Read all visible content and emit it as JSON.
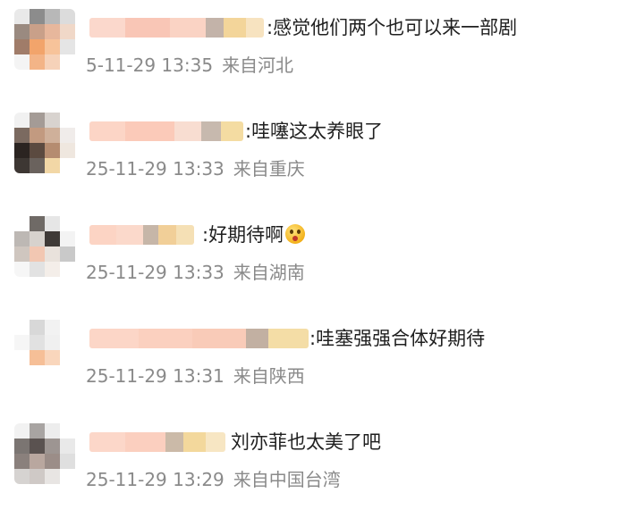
{
  "comments": [
    {
      "text": ":感觉他们两个也可以来一部剧",
      "date": "5-11-29 13:35",
      "location": "来自河北"
    },
    {
      "text": ":哇噻这太养眼了",
      "date": "25-11-29 13:33",
      "location": "来自重庆"
    },
    {
      "text": ":好期待啊",
      "emoji": "surprised-face-emoji",
      "date": "25-11-29 13:33",
      "location": "来自湖南"
    },
    {
      "text": ":哇塞强强合体好期待",
      "date": "25-11-29 13:31",
      "location": "来自陕西"
    },
    {
      "text": "刘亦菲也太美了吧",
      "date": "25-11-29 13:29",
      "location": "来自中国台湾"
    }
  ],
  "colors": {
    "text": "#1f1f1f",
    "meta": "#8a8a8a",
    "background": "#ffffff"
  }
}
